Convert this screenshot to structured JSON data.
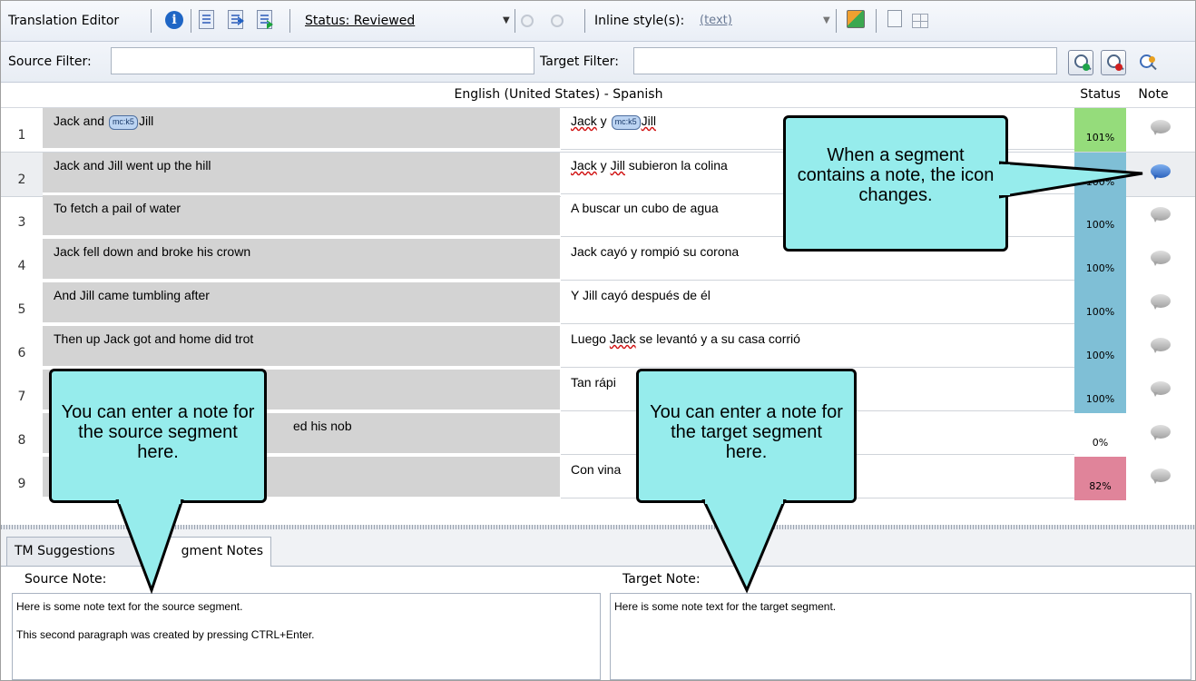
{
  "toolbar": {
    "title": "Translation Editor",
    "status_select": "Status: Reviewed",
    "inline_label": "Inline style(s):",
    "inline_value": "(text)"
  },
  "filters": {
    "source_label": "Source Filter:",
    "target_label": "Target Filter:",
    "source_value": "",
    "target_value": ""
  },
  "grid": {
    "language_header": "English (United States) - Spanish",
    "status_header": "Status",
    "note_header": "Note",
    "rows": [
      {
        "num": "1",
        "source_pre": "Jack and ",
        "tag": "mc:k5",
        "source_post": "Jill",
        "target_pre": "Jack",
        "target_mid": " y ",
        "target_tag": "mc:k5",
        "target_post": "Jill",
        "status": "101%",
        "color": "#95dc7b",
        "has_note": false
      },
      {
        "num": "2",
        "source": "Jack and Jill went up the hill",
        "target_a": "Jack",
        "target_b": " y ",
        "target_c": "Jill",
        "target_d": " subieron la colina",
        "status": "100%",
        "color": "#7fbfd6",
        "has_note": true
      },
      {
        "num": "3",
        "source": "To fetch a pail of water",
        "target": "A buscar un cubo de agua",
        "status": "100%",
        "color": "#7fbfd6",
        "has_note": false
      },
      {
        "num": "4",
        "source": "Jack fell down and broke his crown",
        "target": "Jack cayó y rompió su corona",
        "status": "100%",
        "color": "#7fbfd6",
        "has_note": false
      },
      {
        "num": "5",
        "source": "And Jill came tumbling after",
        "target": "Y Jill cayó después de él",
        "status": "100%",
        "color": "#7fbfd6",
        "has_note": false
      },
      {
        "num": "6",
        "source": "Then up Jack got and home did trot",
        "target_a": "Luego ",
        "target_b": "Jack",
        "target_c": " se levantó y a su casa corrió",
        "status": "100%",
        "color": "#7fbfd6",
        "has_note": false
      },
      {
        "num": "7",
        "source": "",
        "target": "Tan rápi",
        "status": "100%",
        "color": "#7fbfd6",
        "has_note": false
      },
      {
        "num": "8",
        "source": "ed his nob",
        "target": "",
        "status": "0%",
        "color": "#ffffff",
        "has_note": false
      },
      {
        "num": "9",
        "source": "",
        "target": "Con vina",
        "status": "82%",
        "color": "#e0849a",
        "has_note": false
      }
    ]
  },
  "tabs": [
    {
      "label": "TM Suggestions"
    },
    {
      "label": "gment Notes"
    }
  ],
  "notes": {
    "source_label": "Source Note:",
    "target_label": "Target Note:",
    "source_text_1": "Here is some note text for the source segment.",
    "source_text_2": "This second paragraph was created by pressing CTRL+Enter.",
    "target_text": "Here is some note text for the target segment."
  },
  "callouts": {
    "note_icon": "When a segment contains a note, the icon changes.",
    "source_note": "You can enter a note for the source segment here.",
    "target_note": "You can enter a note for the target segment here."
  },
  "icons": [
    "info-icon",
    "properties-icon",
    "previous-icon",
    "next-icon",
    "toggle-icon",
    "export-icon",
    "preview-icon",
    "grid-icon",
    "filter-apply-icon",
    "filter-clear-icon",
    "filter-options-icon",
    "note-icon"
  ]
}
